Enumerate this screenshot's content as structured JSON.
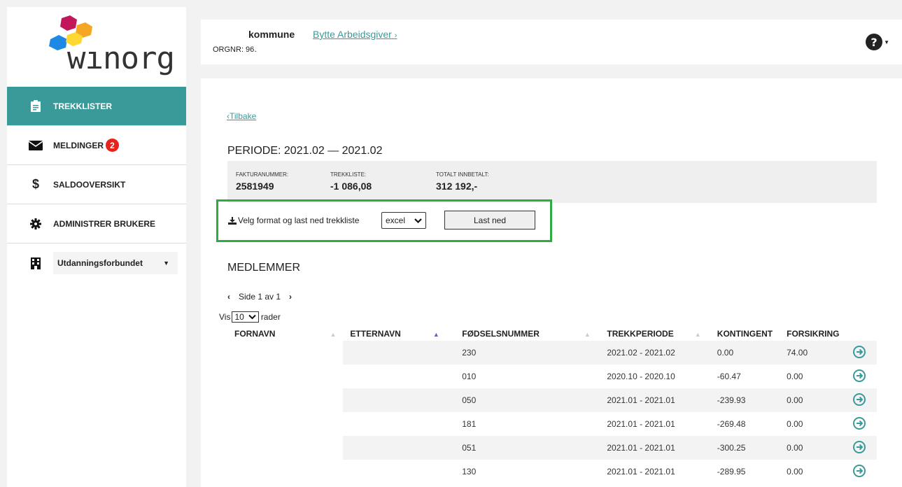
{
  "sidebar": {
    "logo_text": "wınorg",
    "items": [
      {
        "label": "TREKKLISTER",
        "icon": "clipboard-icon"
      },
      {
        "label": "MELDINGER",
        "icon": "envelope-icon",
        "badge": "2"
      },
      {
        "label": "SALDOOVERSIKT",
        "icon": "dollar-icon"
      },
      {
        "label": "ADMINISTRER BRUKERE",
        "icon": "gear-icon"
      }
    ],
    "org_select": "Utdanningsforbundet"
  },
  "header": {
    "company": "kommune",
    "switch_link": "Bytte Arbeidsgiver",
    "orgnr": "ORGNR: 96․",
    "help_icon": "question-circle-icon"
  },
  "main": {
    "back_link": "Tilbake",
    "periode": "PERIODE: 2021.02 — 2021.02",
    "info": {
      "faktura_label": "FAKTURANUMMER:",
      "faktura_value": "2581949",
      "trekk_label": "TREKKLISTE:",
      "trekk_value": "-1 086,08",
      "totalt_label": "TOTALT INNBETALT:",
      "totalt_value": "312 192,-"
    },
    "download": {
      "text": "Velg format og last ned trekkliste",
      "format": "excel",
      "button": "Last ned"
    },
    "section_title": "MEDLEMMER",
    "pager": "Side 1 av 1",
    "vis_prefix": "Vis",
    "vis_value": "10",
    "vis_suffix": "rader"
  },
  "table": {
    "headers": [
      "FORNAVN",
      "ETTERNAVN",
      "FØDSELSNUMMER",
      "TREKKPERIODE",
      "KONTINGENT",
      "FORSIKRING"
    ],
    "rows": [
      {
        "fnr": "230",
        "periode": "2021.02 - 2021.02",
        "kontingent": "0.00",
        "forsikring": "74.00"
      },
      {
        "fnr": "010",
        "periode": "2020.10 - 2020.10",
        "kontingent": "-60.47",
        "forsikring": "0.00"
      },
      {
        "fnr": "050",
        "periode": "2021.01 - 2021.01",
        "kontingent": "-239.93",
        "forsikring": "0.00"
      },
      {
        "fnr": "181",
        "periode": "2021.01 - 2021.01",
        "kontingent": "-269.48",
        "forsikring": "0.00"
      },
      {
        "fnr": "051",
        "periode": "2021.01 - 2021.01",
        "kontingent": "-300.25",
        "forsikring": "0.00"
      },
      {
        "fnr": "130",
        "periode": "2021.01 - 2021.01",
        "kontingent": "-289.95",
        "forsikring": "0.00"
      }
    ]
  },
  "colors": {
    "accent": "#3a9a9a",
    "highlight_border": "#2eac3f",
    "badge": "#e8231c"
  }
}
